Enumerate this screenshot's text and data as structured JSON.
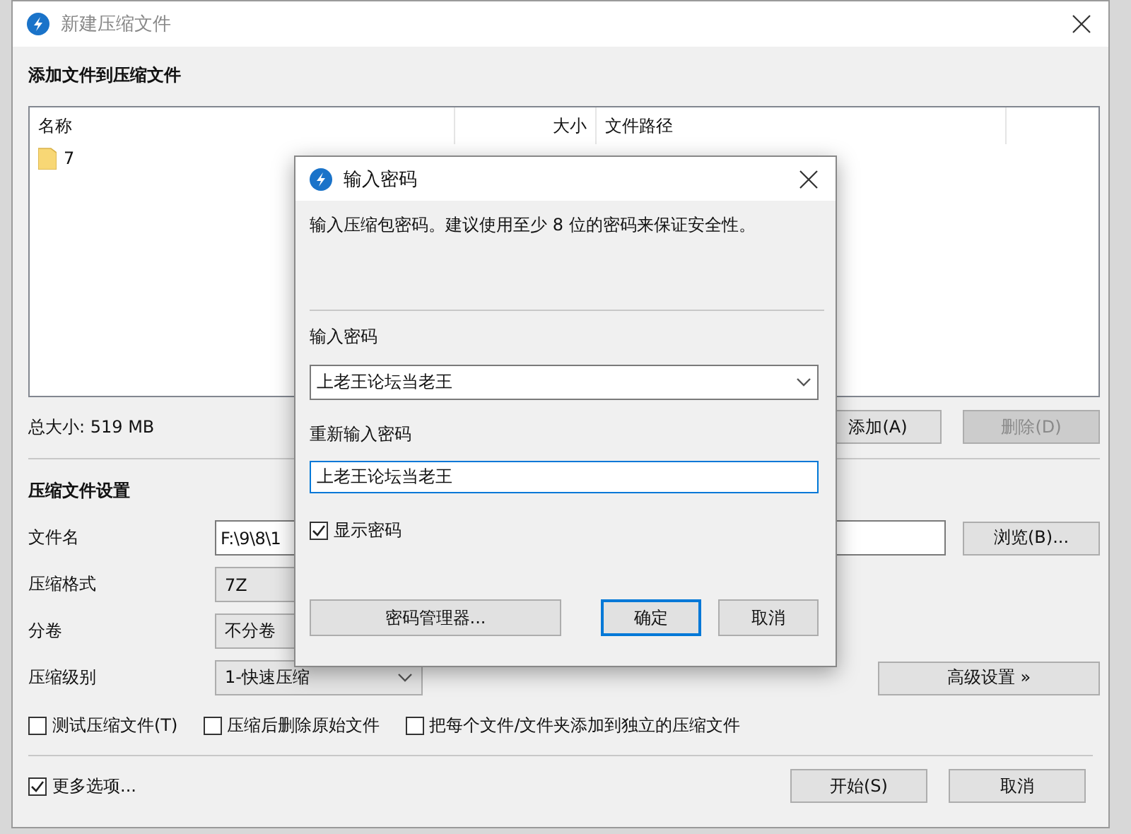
{
  "main_window": {
    "title": "新建压缩文件",
    "active": false
  },
  "files_section": {
    "heading": "添加文件到压缩文件",
    "columns": [
      "名称",
      "大小",
      "文件路径"
    ],
    "rows": [
      {
        "name": "7"
      }
    ],
    "total": "总大小: 519 MB",
    "buttons": [
      {
        "label": "添加(A)",
        "disabled": false
      },
      {
        "label": "删除(D)",
        "disabled": true
      }
    ]
  },
  "settings": {
    "heading": "压缩文件设置",
    "fields": [
      {
        "kind": "text",
        "label": "文件名",
        "value": "F:\\9\\8\\1",
        "button": "浏览(B)..."
      },
      {
        "kind": "select",
        "label": "压缩格式",
        "value": "7Z"
      },
      {
        "kind": "select",
        "label": "分卷",
        "value": "不分卷"
      },
      {
        "kind": "select",
        "label": "压缩级别",
        "value": "1-快速压缩",
        "button": "高级设置 »"
      }
    ],
    "options": [
      {
        "label": "测试压缩文件(T)",
        "checked": false
      },
      {
        "label": "压缩后删除原始文件",
        "checked": false
      },
      {
        "label": "把每个文件/文件夹添加到独立的压缩文件",
        "checked": false
      }
    ]
  },
  "footer": {
    "more_options": {
      "label": "更多选项...",
      "checked": true
    },
    "buttons": [
      {
        "label": "开始(S)"
      },
      {
        "label": "取消"
      }
    ]
  },
  "dialog": {
    "title": "输入密码",
    "description": "输入压缩包密码。建议使用至少 8 位的密码来保证安全性。",
    "password_label": "输入密码",
    "password": "上老王论坛当老王",
    "confirm_label": "重新输入密码",
    "confirm": "上老王论坛当老王",
    "show_password": {
      "label": "显示密码",
      "checked": true
    },
    "buttons": [
      {
        "label": "密码管理器...",
        "default": false
      },
      {
        "label": "确定",
        "default": true
      },
      {
        "label": "取消",
        "default": false
      }
    ]
  }
}
